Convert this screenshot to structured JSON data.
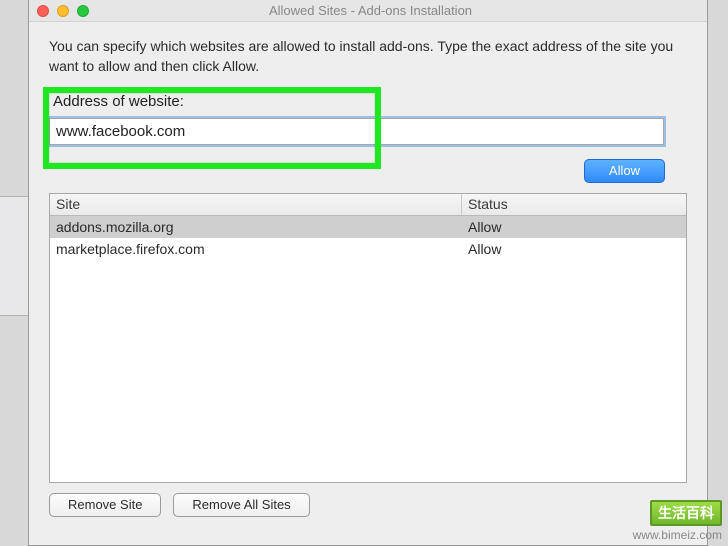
{
  "window": {
    "title": "Allowed Sites - Add-ons Installation"
  },
  "description": "You can specify which websites are allowed to install add-ons. Type the exact address of the site you want to allow and then click Allow.",
  "address": {
    "label": "Address of website:",
    "value": "www.facebook.com"
  },
  "buttons": {
    "allow": "Allow",
    "remove_site": "Remove Site",
    "remove_all": "Remove All Sites"
  },
  "table": {
    "headers": {
      "site": "Site",
      "status": "Status"
    },
    "selected_index": 0,
    "rows": [
      {
        "site": "addons.mozilla.org",
        "status": "Allow"
      },
      {
        "site": "marketplace.firefox.com",
        "status": "Allow"
      }
    ]
  },
  "watermark": {
    "text": "生活百科",
    "url": "www.bimeiz.com"
  }
}
